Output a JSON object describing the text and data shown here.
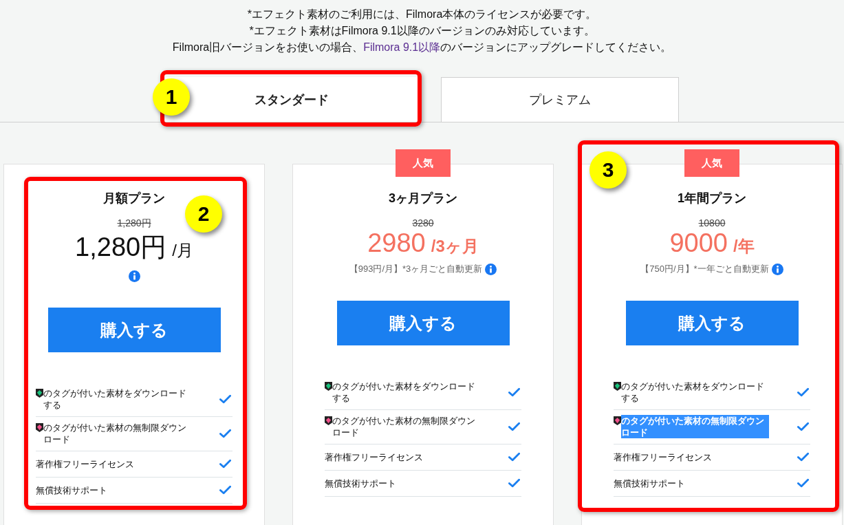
{
  "notice": [
    {
      "text": "*エフェクト素材のご利用には、Filmora本体のライセンスが必要です。"
    },
    {
      "text": "*エフェクト素材はFilmora 9.1以降のバージョンのみ対応しています。"
    },
    {
      "text": "Filmora旧バージョンをお使いの場合、",
      "link": "Filmora 9.1以降",
      "after": "のバージョンにアップグレードしてください。"
    }
  ],
  "tabs": [
    {
      "label": "スタンダード",
      "selected": true,
      "annotation": {
        "number": "1",
        "kind": "tab"
      }
    },
    {
      "label": "プレミアム",
      "selected": false
    }
  ],
  "plans": [
    {
      "title": "月額プラン",
      "old_price": "1,280円",
      "price": "1,280円",
      "unit": "/月",
      "accent": false,
      "button": "購入する",
      "annotation": {
        "number": "2",
        "kind": "inner"
      },
      "features": [
        {
          "kind": "green-tag",
          "text": "のタグが付いた素材をダウンロードする",
          "included": true,
          "highlighted": false
        },
        {
          "kind": "pink-tag",
          "text": "のタグが付いた素材の無制限ダウンロード",
          "included": true,
          "highlighted": false
        },
        {
          "kind": "plain",
          "text": "著作権フリーライセンス",
          "included": true,
          "highlighted": false
        },
        {
          "kind": "plain",
          "text": "無償技術サポート",
          "included": true,
          "highlighted": false
        }
      ]
    },
    {
      "badge": "人気",
      "title": "3ヶ月プラン",
      "old_price": "3280",
      "price": "2980",
      "unit": "/3ヶ月",
      "accent": true,
      "note": "【993円/月】*3ヶ月ごと自動更新",
      "button": "購入する",
      "features": [
        {
          "kind": "green-tag",
          "text": "のタグが付いた素材をダウンロードする",
          "included": true,
          "highlighted": false
        },
        {
          "kind": "pink-tag",
          "text": "のタグが付いた素材の無制限ダウンロード",
          "included": true,
          "highlighted": false
        },
        {
          "kind": "plain",
          "text": "著作権フリーライセンス",
          "included": true,
          "highlighted": false
        },
        {
          "kind": "plain",
          "text": "無償技術サポート",
          "included": true,
          "highlighted": false
        }
      ]
    },
    {
      "badge": "人気",
      "title": "1年間プラン",
      "old_price": "10800",
      "price": "9000",
      "unit": "/年",
      "accent": true,
      "note": "【750円/月】*一年ごと自動更新",
      "button": "購入する",
      "annotation": {
        "number": "3",
        "kind": "outer"
      },
      "features": [
        {
          "kind": "green-tag",
          "text": "のタグが付いた素材をダウンロードする",
          "included": true,
          "highlighted": false
        },
        {
          "kind": "pink-tag",
          "text": "のタグが付いた素材の無制限ダウンロード",
          "included": true,
          "highlighted": true
        },
        {
          "kind": "plain",
          "text": "著作権フリーライセンス",
          "included": true,
          "highlighted": false
        },
        {
          "kind": "plain",
          "text": "無償技術サポート",
          "included": true,
          "highlighted": false
        }
      ]
    }
  ]
}
